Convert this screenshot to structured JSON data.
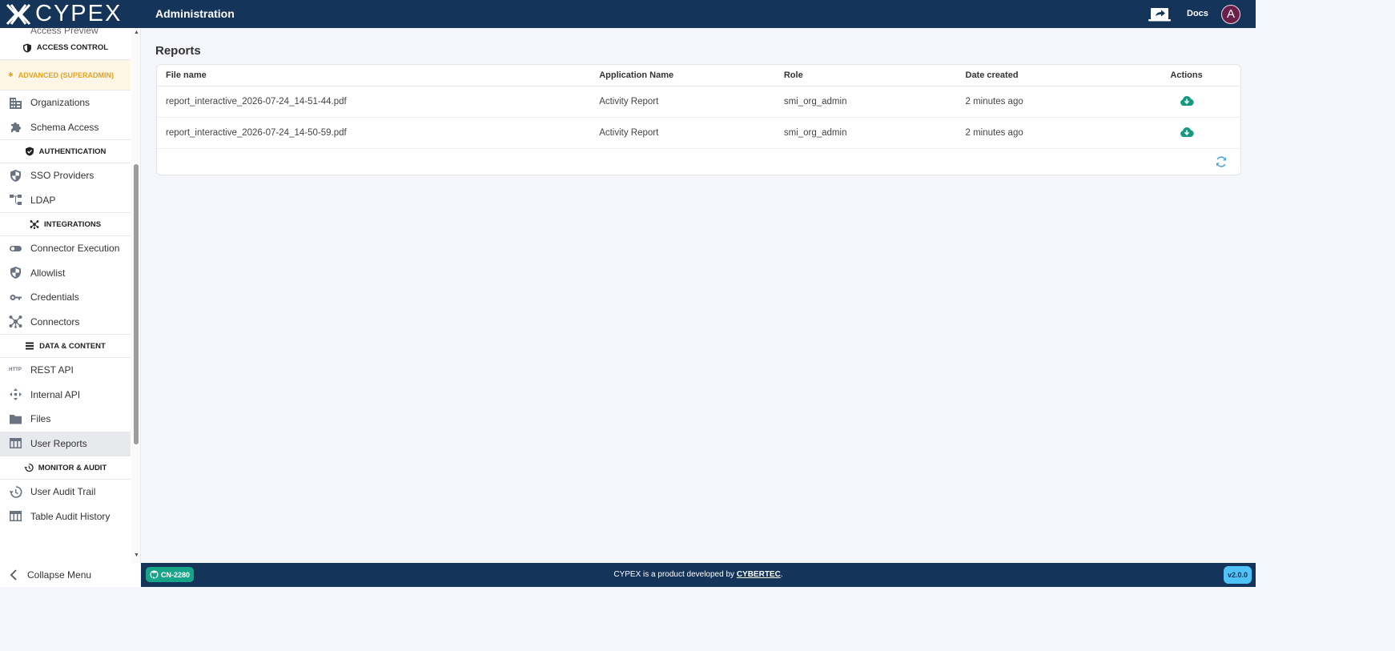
{
  "app": {
    "brand": "CYPEX",
    "title": "Administration"
  },
  "header": {
    "docs_label": "Docs",
    "avatar_initial": "A"
  },
  "sidebar": {
    "partial_item": "Access Preview",
    "sections": {
      "access_control": "ACCESS CONTROL",
      "advanced": "ADVANCED (SUPERADMIN)",
      "authentication": "AUTHENTICATION",
      "integrations": "INTEGRATIONS",
      "data_content": "DATA & CONTENT",
      "monitor_audit": "MONITOR & AUDIT"
    },
    "items": {
      "organizations": "Organizations",
      "schema_access": "Schema Access",
      "sso_providers": "SSO Providers",
      "ldap": "LDAP",
      "connector_execution": "Connector Execution",
      "allowlist": "Allowlist",
      "credentials": "Credentials",
      "connectors": "Connectors",
      "rest_api": "REST API",
      "internal_api": "Internal API",
      "files": "Files",
      "user_reports": "User Reports",
      "user_audit_trail": "User Audit Trail",
      "table_audit_history": "Table Audit History"
    },
    "active_item": "User Reports",
    "collapse_label": "Collapse Menu",
    "rest_icon_text": "HTTP"
  },
  "main": {
    "page_title": "Reports",
    "table": {
      "headers": [
        "File name",
        "Application Name",
        "Role",
        "Date created",
        "Actions"
      ],
      "rows": [
        {
          "file": "report_interactive_2026-07-24_14-51-44.pdf",
          "app": "Activity Report",
          "role": "smi_org_admin",
          "date": "2 minutes ago",
          "action_icon": "cloud-download-icon"
        },
        {
          "file": "report_interactive_2026-07-24_14-50-59.pdf",
          "app": "Activity Report",
          "role": "smi_org_admin",
          "date": "2 minutes ago",
          "action_icon": "cloud-download-icon"
        }
      ]
    }
  },
  "footer": {
    "branch": "CN-2280",
    "text_prefix": "CYPEX is a product developed by ",
    "link": "CYBERTEC",
    "text_suffix": ".",
    "version": "v2.0.0"
  },
  "colors": {
    "header_bg": "#14345a",
    "accent_teal": "#17a589",
    "advanced_accent": "#e6a31e",
    "version_badge": "#4fc3f7",
    "download_icon": "#149980",
    "refresh_icon": "#4aa3df"
  }
}
